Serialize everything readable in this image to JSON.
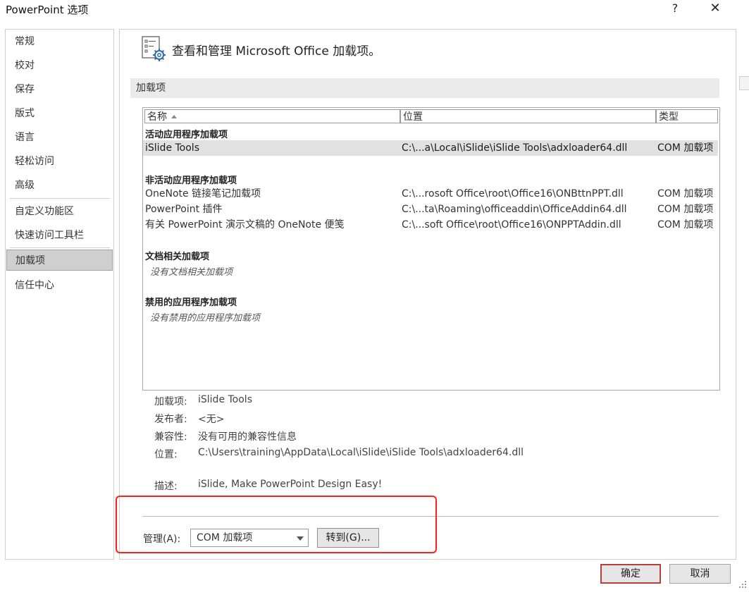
{
  "window": {
    "title": "PowerPoint 选项",
    "help": "?",
    "close": "✕"
  },
  "sidebar": {
    "items": [
      {
        "label": "常规"
      },
      {
        "label": "校对"
      },
      {
        "label": "保存"
      },
      {
        "label": "版式"
      },
      {
        "label": "语言"
      },
      {
        "label": "轻松访问"
      },
      {
        "label": "高级"
      },
      {
        "label": "自定义功能区"
      },
      {
        "label": "快速访问工具栏"
      },
      {
        "label": "加载项"
      },
      {
        "label": "信任中心"
      }
    ],
    "active_index": 9
  },
  "header": {
    "text": "查看和管理 Microsoft Office 加载项。"
  },
  "section": {
    "title": "加载项"
  },
  "list": {
    "columns": [
      "名称",
      "位置",
      "类型"
    ],
    "groups": [
      {
        "title": "活动应用程序加载项",
        "rows": [
          {
            "name": "iSlide Tools",
            "location": "C:\\...a\\Local\\iSlide\\iSlide Tools\\adxloader64.dll",
            "type": "COM 加载项",
            "selected": true
          }
        ]
      },
      {
        "title": "非活动应用程序加载项",
        "rows": [
          {
            "name": "OneNote 链接笔记加载项",
            "location": "C:\\...rosoft Office\\root\\Office16\\ONBttnPPT.dll",
            "type": "COM 加载项"
          },
          {
            "name": "PowerPoint 插件",
            "location": "C:\\...ta\\Roaming\\officeaddin\\OfficeAddin64.dll",
            "type": "COM 加载项"
          },
          {
            "name": "有关 PowerPoint 演示文稿的 OneNote 便笺",
            "location": "C:\\...soft Office\\root\\Office16\\ONPPTAddin.dll",
            "type": "COM 加载项"
          }
        ]
      },
      {
        "title": "文档相关加载项",
        "empty": "没有文档相关加载项"
      },
      {
        "title": "禁用的应用程序加载项",
        "empty": "没有禁用的应用程序加载项"
      }
    ]
  },
  "details": {
    "addin_label": "加载项:",
    "addin_value": "iSlide Tools",
    "publisher_label": "发布者:",
    "publisher_value": "<无>",
    "compat_label": "兼容性:",
    "compat_value": "没有可用的兼容性信息",
    "location_label": "位置:",
    "location_value": "C:\\Users\\training\\AppData\\Local\\iSlide\\iSlide Tools\\adxloader64.dll",
    "desc_label": "描述:",
    "desc_value": "iSlide, Make PowerPoint Design Easy!"
  },
  "manage": {
    "label": "管理(A):",
    "selected": "COM 加载项",
    "goto": "转到(G)..."
  },
  "buttons": {
    "ok": "确定",
    "cancel": "取消"
  }
}
